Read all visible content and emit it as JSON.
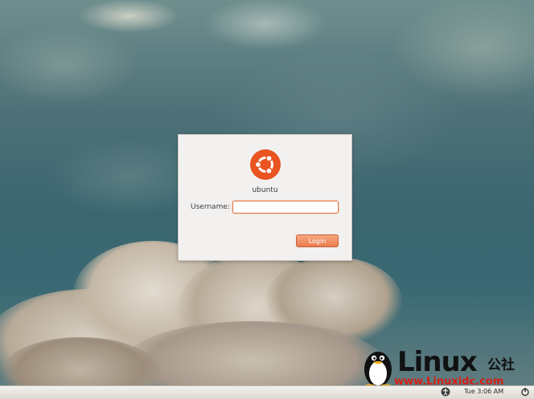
{
  "login": {
    "hostname": "ubuntu",
    "username_label": "Username:",
    "username_value": "",
    "login_button": "Login",
    "logo_icon": "ubuntu-logo-icon",
    "accent_color": "#e95420"
  },
  "panel": {
    "clock": "Tue  3:06 AM",
    "icons": [
      "accessibility-icon",
      "power-icon"
    ]
  },
  "watermark": {
    "brand": "Linux",
    "suffix": "公社",
    "url": "www.Linuxidc.com"
  }
}
